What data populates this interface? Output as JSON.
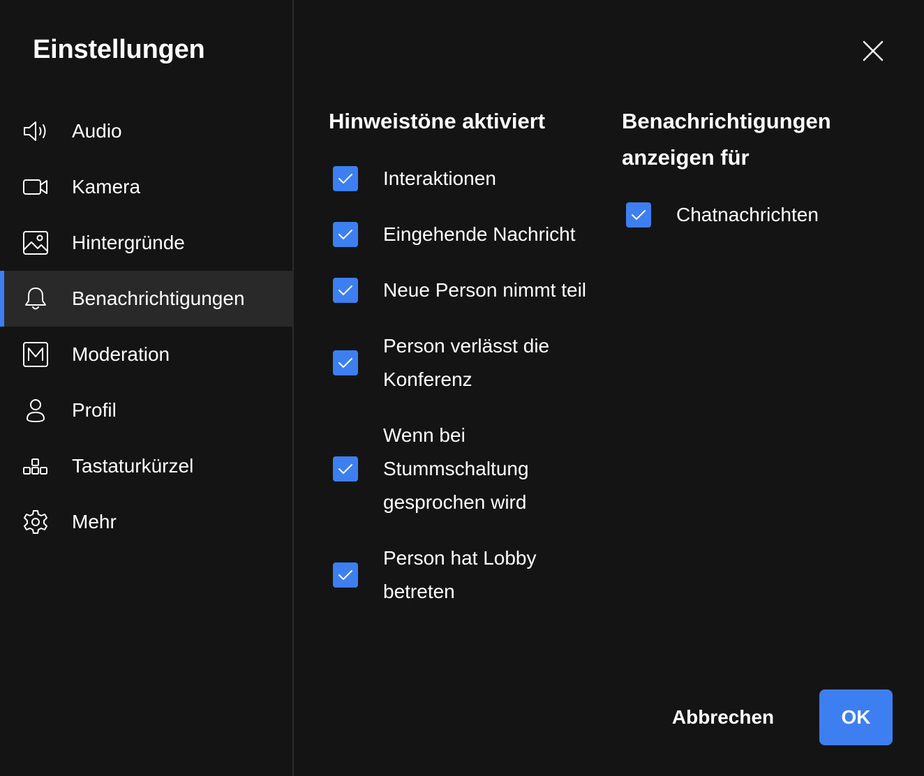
{
  "sidebar": {
    "title": "Einstellungen",
    "items": [
      {
        "label": "Audio",
        "icon": "speaker-icon",
        "active": false
      },
      {
        "label": "Kamera",
        "icon": "camera-icon",
        "active": false
      },
      {
        "label": "Hintergründe",
        "icon": "image-icon",
        "active": false
      },
      {
        "label": "Benachrichtigungen",
        "icon": "bell-icon",
        "active": true
      },
      {
        "label": "Moderation",
        "icon": "moderation-icon",
        "active": false
      },
      {
        "label": "Profil",
        "icon": "user-icon",
        "active": false
      },
      {
        "label": "Tastaturkürzel",
        "icon": "shortcuts-icon",
        "active": false
      },
      {
        "label": "Mehr",
        "icon": "gear-icon",
        "active": false
      }
    ]
  },
  "sounds": {
    "title": "Hinweistöne aktiviert",
    "options": [
      {
        "line1": "Interaktionen",
        "checked": true
      },
      {
        "line1": "Eingehende Nachricht",
        "checked": true
      },
      {
        "line1": "Neue Person nimmt teil",
        "checked": true
      },
      {
        "line1": "Person verlässt die",
        "line2": "Konferenz",
        "checked": true
      },
      {
        "line1": "Wenn bei",
        "line2": "Stummschaltung",
        "line3": "gesprochen wird",
        "checked": true
      },
      {
        "line1": "Person hat Lobby",
        "line2": "betreten",
        "checked": true
      }
    ]
  },
  "notifications": {
    "title_line1": "Benachrichtigungen",
    "title_line2": "anzeigen für",
    "options": [
      {
        "label": "Chatnachrichten",
        "checked": true
      }
    ]
  },
  "footer": {
    "cancel_label": "Abbrechen",
    "ok_label": "OK"
  },
  "colors": {
    "background": "#141414",
    "active_item_bg": "#292929",
    "accent": "#3d7ef0"
  }
}
